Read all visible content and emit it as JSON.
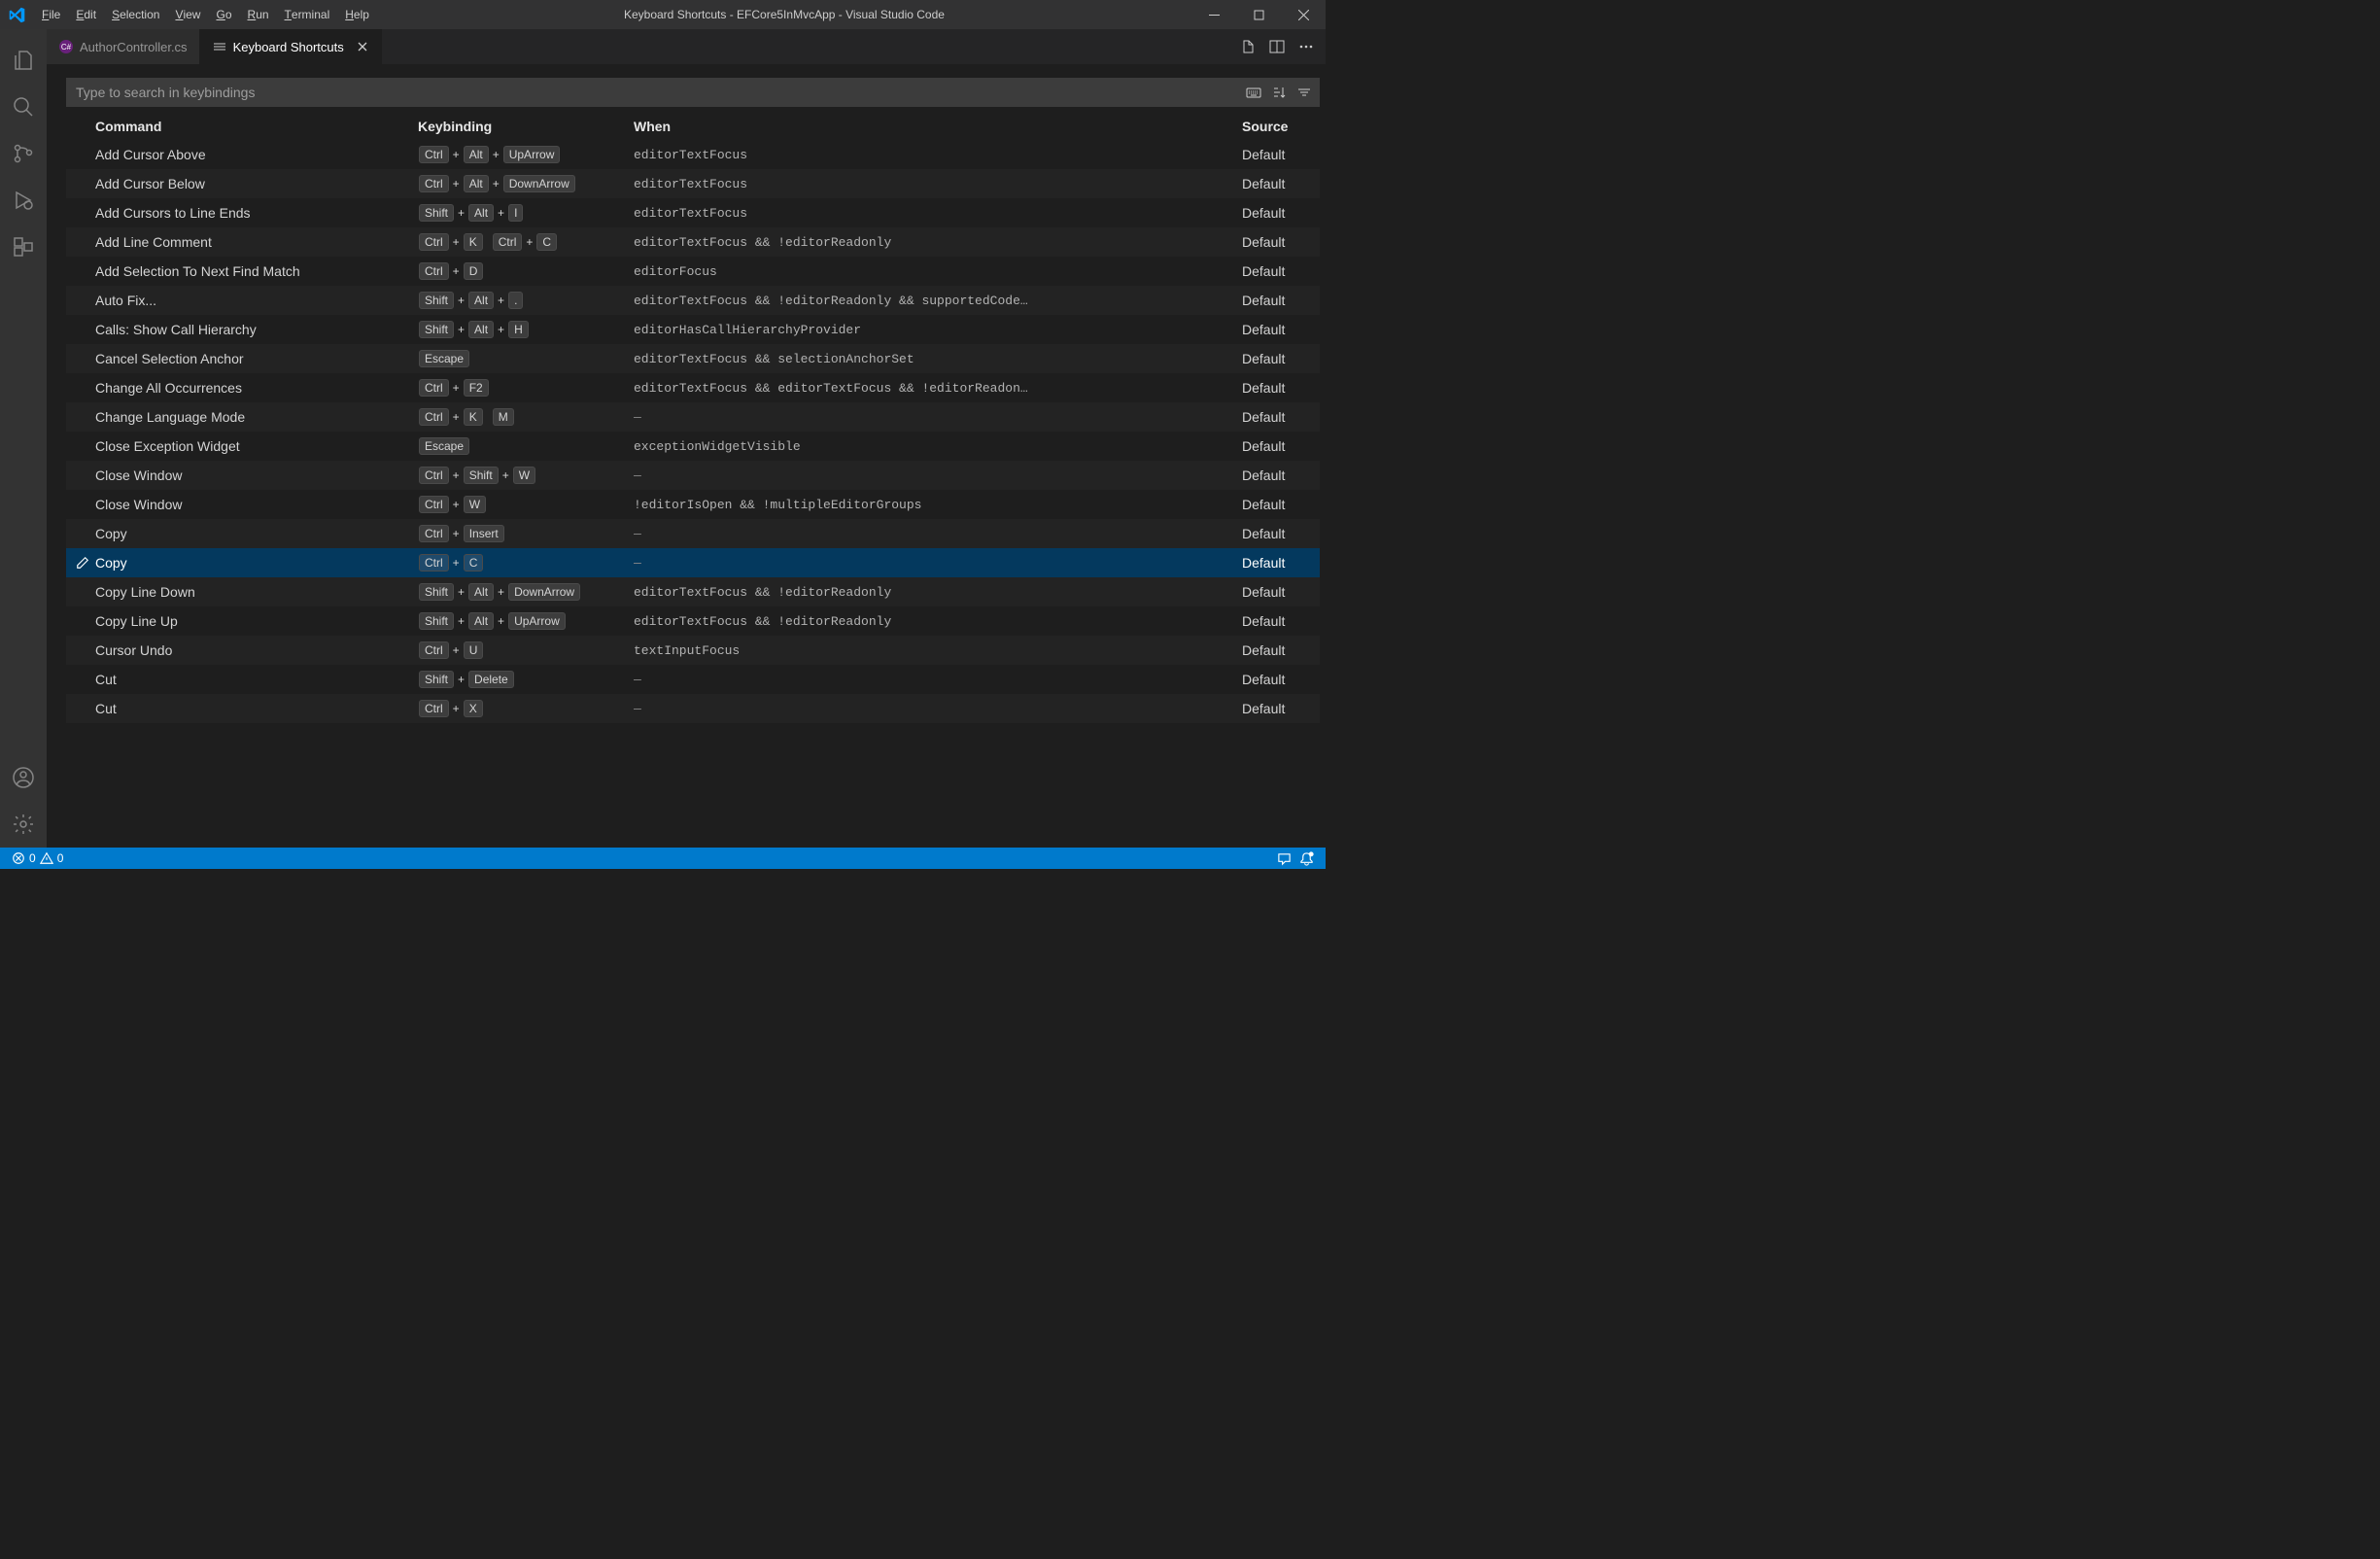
{
  "title": "Keyboard Shortcuts - EFCore5InMvcApp - Visual Studio Code",
  "menu": [
    "File",
    "Edit",
    "Selection",
    "View",
    "Go",
    "Run",
    "Terminal",
    "Help"
  ],
  "tabs": [
    {
      "label": "AuthorController.cs",
      "active": false,
      "icon": "csharp"
    },
    {
      "label": "Keyboard Shortcuts",
      "active": true,
      "icon": "keyboard"
    }
  ],
  "search": {
    "placeholder": "Type to search in keybindings"
  },
  "columns": {
    "command": "Command",
    "keybinding": "Keybinding",
    "when": "When",
    "source": "Source"
  },
  "rows": [
    {
      "command": "Add Cursor Above",
      "keys": [
        [
          "Ctrl",
          "Alt",
          "UpArrow"
        ]
      ],
      "when": "editorTextFocus",
      "source": "Default"
    },
    {
      "command": "Add Cursor Below",
      "keys": [
        [
          "Ctrl",
          "Alt",
          "DownArrow"
        ]
      ],
      "when": "editorTextFocus",
      "source": "Default"
    },
    {
      "command": "Add Cursors to Line Ends",
      "keys": [
        [
          "Shift",
          "Alt",
          "I"
        ]
      ],
      "when": "editorTextFocus",
      "source": "Default"
    },
    {
      "command": "Add Line Comment",
      "keys": [
        [
          "Ctrl",
          "K"
        ],
        [
          "Ctrl",
          "C"
        ]
      ],
      "when": "editorTextFocus && !editorReadonly",
      "source": "Default"
    },
    {
      "command": "Add Selection To Next Find Match",
      "keys": [
        [
          "Ctrl",
          "D"
        ]
      ],
      "when": "editorFocus",
      "source": "Default"
    },
    {
      "command": "Auto Fix...",
      "keys": [
        [
          "Shift",
          "Alt",
          "."
        ]
      ],
      "when": "editorTextFocus && !editorReadonly && supportedCode…",
      "source": "Default"
    },
    {
      "command": "Calls: Show Call Hierarchy",
      "keys": [
        [
          "Shift",
          "Alt",
          "H"
        ]
      ],
      "when": "editorHasCallHierarchyProvider",
      "source": "Default"
    },
    {
      "command": "Cancel Selection Anchor",
      "keys": [
        [
          "Escape"
        ]
      ],
      "when": "editorTextFocus && selectionAnchorSet",
      "source": "Default"
    },
    {
      "command": "Change All Occurrences",
      "keys": [
        [
          "Ctrl",
          "F2"
        ]
      ],
      "when": "editorTextFocus && editorTextFocus && !editorReadon…",
      "source": "Default"
    },
    {
      "command": "Change Language Mode",
      "keys": [
        [
          "Ctrl",
          "K"
        ],
        [
          "M"
        ]
      ],
      "when": "—",
      "source": "Default"
    },
    {
      "command": "Close Exception Widget",
      "keys": [
        [
          "Escape"
        ]
      ],
      "when": "exceptionWidgetVisible",
      "source": "Default"
    },
    {
      "command": "Close Window",
      "keys": [
        [
          "Ctrl",
          "Shift",
          "W"
        ]
      ],
      "when": "—",
      "source": "Default"
    },
    {
      "command": "Close Window",
      "keys": [
        [
          "Ctrl",
          "W"
        ]
      ],
      "when": "!editorIsOpen && !multipleEditorGroups",
      "source": "Default"
    },
    {
      "command": "Copy",
      "keys": [
        [
          "Ctrl",
          "Insert"
        ]
      ],
      "when": "—",
      "source": "Default"
    },
    {
      "command": "Copy",
      "keys": [
        [
          "Ctrl",
          "C"
        ]
      ],
      "when": "—",
      "source": "Default",
      "selected": true
    },
    {
      "command": "Copy Line Down",
      "keys": [
        [
          "Shift",
          "Alt",
          "DownArrow"
        ]
      ],
      "when": "editorTextFocus && !editorReadonly",
      "source": "Default"
    },
    {
      "command": "Copy Line Up",
      "keys": [
        [
          "Shift",
          "Alt",
          "UpArrow"
        ]
      ],
      "when": "editorTextFocus && !editorReadonly",
      "source": "Default"
    },
    {
      "command": "Cursor Undo",
      "keys": [
        [
          "Ctrl",
          "U"
        ]
      ],
      "when": "textInputFocus",
      "source": "Default"
    },
    {
      "command": "Cut",
      "keys": [
        [
          "Shift",
          "Delete"
        ]
      ],
      "when": "—",
      "source": "Default"
    },
    {
      "command": "Cut",
      "keys": [
        [
          "Ctrl",
          "X"
        ]
      ],
      "when": "—",
      "source": "Default"
    }
  ],
  "status": {
    "errors": "0",
    "warnings": "0"
  }
}
